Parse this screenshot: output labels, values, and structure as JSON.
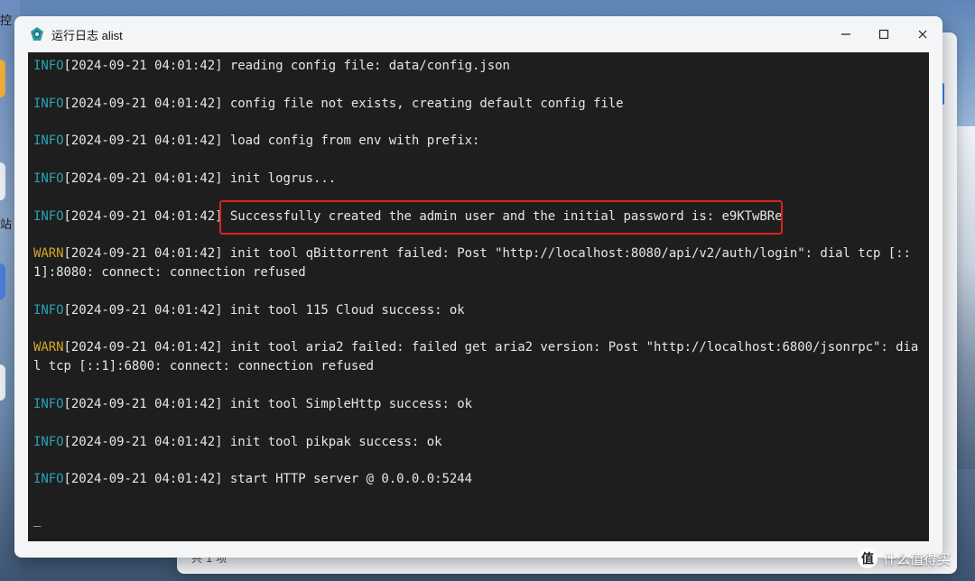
{
  "desktop": {
    "edge_text_1": "控",
    "edge_text_2": "站",
    "background_window_footer": "共 1 项"
  },
  "window": {
    "title": "运行日志 alist",
    "controls": {
      "minimize": "—",
      "maximize": "☐",
      "close": "✕"
    }
  },
  "log": {
    "lines": [
      {
        "level": "INFO",
        "text": "[2024-09-21 04:01:42] reading config file: data/config.json"
      },
      {
        "level": "INFO",
        "text": "[2024-09-21 04:01:42] config file not exists, creating default config file"
      },
      {
        "level": "INFO",
        "text": "[2024-09-21 04:01:42] load config from env with prefix:"
      },
      {
        "level": "INFO",
        "text": "[2024-09-21 04:01:42] init logrus..."
      },
      {
        "level": "INFO",
        "text": "[2024-09-21 04:01:42] Successfully created the admin user and the initial password is: e9KTwBRe"
      },
      {
        "level": "WARN",
        "text": "[2024-09-21 04:01:42] init tool qBittorrent failed: Post \"http://localhost:8080/api/v2/auth/login\": dial tcp [::1]:8080: connect: connection refused"
      },
      {
        "level": "INFO",
        "text": "[2024-09-21 04:01:42] init tool 115 Cloud success: ok"
      },
      {
        "level": "WARN",
        "text": "[2024-09-21 04:01:42] init tool aria2 failed: failed get aria2 version: Post \"http://localhost:6800/jsonrpc\": dial tcp [::1]:6800: connect: connection refused"
      },
      {
        "level": "INFO",
        "text": "[2024-09-21 04:01:42] init tool SimpleHttp success: ok"
      },
      {
        "level": "INFO",
        "text": "[2024-09-21 04:01:42] init tool pikpak success: ok"
      },
      {
        "level": "INFO",
        "text": "[2024-09-21 04:01:42] start HTTP server @ 0.0.0.0:5244"
      }
    ],
    "cursor": "_",
    "highlighted_line_index": 4
  },
  "colors": {
    "info": "#2aa3b0",
    "warn": "#d4a52a",
    "highlight": "#e0201e",
    "console_bg": "#1e1e1e"
  },
  "watermark": {
    "icon_glyph": "值",
    "text": "什么值得买"
  }
}
